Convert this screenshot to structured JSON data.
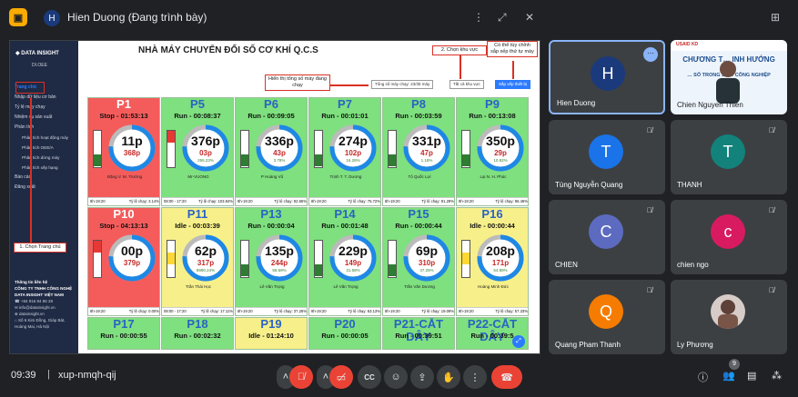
{
  "meeting": {
    "presenter_initial": "H",
    "presenter_title": "Hien Duong (Đang trình bày)",
    "time": "09:39",
    "separator": "|",
    "code": "xup-nmqh-qij",
    "participant_count": "9"
  },
  "dashboard": {
    "logo": "DATA INSIGHT",
    "logo_sub": "DI.OEE",
    "title": "NHÀ MÁY CHUYỂN ĐỔI SỐ CƠ KHÍ Q.C.S",
    "filter_count": "Tổng số máy chạy: 23/35 máy",
    "filter_area": "Tất cả khu vực",
    "sort_button": "Sắp xếp thiết bị",
    "menu": [
      {
        "label": "Trang chủ",
        "active": true,
        "sub": false
      },
      {
        "label": "Nhập dữ liệu cơ bản",
        "active": false,
        "sub": false
      },
      {
        "label": "Tỷ lệ máy chạy",
        "active": false,
        "sub": false
      },
      {
        "label": "Nhiệm vụ sản xuất",
        "active": false,
        "sub": false
      },
      {
        "label": "Phân tích",
        "active": false,
        "sub": false
      },
      {
        "label": "Phân tích hoạt động máy",
        "active": false,
        "sub": true
      },
      {
        "label": "Phân tích OEE/A",
        "active": false,
        "sub": true
      },
      {
        "label": "Phân tích dừng máy",
        "active": false,
        "sub": true
      },
      {
        "label": "Phân tích xếp hạng",
        "active": false,
        "sub": true
      },
      {
        "label": "Báo cáo",
        "active": false,
        "sub": false
      },
      {
        "label": "Đăng xuất",
        "active": false,
        "sub": false
      }
    ],
    "contact": {
      "heading": "Thông tin liên hệ",
      "company": "CÔNG TY TNHH CÔNG NGHỆ DATA INSIGHT VIỆT NAM",
      "phone": "+84 916 84 86 28",
      "email": "info@datainsight.vn",
      "web": "datainsight.vn",
      "address": "Số 6 Kim Đồng, Giáp Bát, Hoàng Mai, Hà Nội"
    },
    "annotations": {
      "home": "1. Chọn Trang chủ",
      "count": "Hiển thị tổng số máy đang chạy",
      "area": "2. Chọn khu vực",
      "sort": "Có thể tùy chỉnh sắp xếp thứ tự máy"
    },
    "machines": [
      {
        "name": "P1",
        "status": "Stop - 01:53:13",
        "color": "red",
        "main": "11p",
        "sub": "368p",
        "pct": "0.00%",
        "operator": "Đặng V. M. Trường",
        "shift": "8h-19:20",
        "rate": "Tỷ lệ chạy: 3.14%",
        "light": "green"
      },
      {
        "name": "P5",
        "status": "Run - 00:08:37",
        "color": "green",
        "main": "376p",
        "sub": "03p",
        "pct": "255.23%",
        "operator": "Mr-VUONG",
        "shift": "08:00 - 17:20",
        "rate": "Tỷ lệ chạy: 103.84%",
        "light": "red"
      },
      {
        "name": "P6",
        "status": "Run - 00:09:05",
        "color": "green",
        "main": "336p",
        "sub": "43p",
        "pct": "3.78%",
        "operator": "P Hoàng Vũ",
        "shift": "8h-19:20",
        "rate": "Tỷ lệ chạy: 92.65%",
        "light": "green"
      },
      {
        "name": "P7",
        "status": "Run - 00:01:01",
        "color": "green",
        "main": "274p",
        "sub": "102p",
        "pct": "16.28%",
        "operator": "Trịnh T. T. Dương",
        "shift": "8h-19:20",
        "rate": "Tỷ lệ chạy: 75.72%",
        "light": "green"
      },
      {
        "name": "P8",
        "status": "Run - 00:03:59",
        "color": "green",
        "main": "331p",
        "sub": "47p",
        "pct": "1.18%",
        "operator": "Tô Quốc Lợi",
        "shift": "8h-19:20",
        "rate": "Tỷ lệ chạy: 91.29%",
        "light": "green"
      },
      {
        "name": "P9",
        "status": "Run - 00:13:08",
        "color": "green",
        "main": "350p",
        "sub": "29p",
        "pct": "10.82%",
        "operator": "Lại N. H. Phúc",
        "shift": "8h-19:20",
        "rate": "Tỷ lệ chạy: 96.46%",
        "light": "green"
      },
      {
        "name": "P10",
        "status": "Stop - 04:13:13",
        "color": "red",
        "main": "00p",
        "sub": "379p",
        "pct": "0.00%",
        "operator": "",
        "shift": "8h-19:20",
        "rate": "Tỷ lệ chạy: 0.00%",
        "light": "red"
      },
      {
        "name": "P11",
        "status": "Idle - 00:03:39",
        "color": "yellow",
        "main": "62p",
        "sub": "317p",
        "pct": "8990.24%",
        "operator": "Trần Thái Học",
        "shift": "08:00 - 17:20",
        "rate": "Tỷ lệ chạy: 17.11%",
        "light": "yellow"
      },
      {
        "name": "P13",
        "status": "Run - 00:00:04",
        "color": "green",
        "main": "135p",
        "sub": "244p",
        "pct": "58.59%",
        "operator": "Lê Văn Trọng",
        "shift": "8h-19:20",
        "rate": "Tỷ lệ chạy: 37.25%",
        "light": "green"
      },
      {
        "name": "P14",
        "status": "Run - 00:01:48",
        "color": "green",
        "main": "229p",
        "sub": "149p",
        "pct": "31.58%",
        "operator": "Lê Văn Trọng",
        "shift": "8h-19:20",
        "rate": "Tỷ lệ chạy: 63.13%",
        "light": "green"
      },
      {
        "name": "P15",
        "status": "Run - 00:00:44",
        "color": "green",
        "main": "69p",
        "sub": "310p",
        "pct": "47.25%",
        "operator": "Trần Văn Dương",
        "shift": "8h-19:20",
        "rate": "Tỷ lệ chạy: 19.09%",
        "light": "green"
      },
      {
        "name": "P16",
        "status": "Idle - 00:00:44",
        "color": "yellow",
        "main": "208p",
        "sub": "171p",
        "pct": "54.89%",
        "operator": "Hoàng Minh Đức",
        "shift": "8h-19:20",
        "rate": "Tỷ lệ chạy: 57.33%",
        "light": "yellow"
      },
      {
        "name": "P17",
        "status": "Run - 00:00:55",
        "color": "green"
      },
      {
        "name": "P18",
        "status": "Run - 00:02:32",
        "color": "green"
      },
      {
        "name": "P19",
        "status": "Idle - 01:24:10",
        "color": "yellow"
      },
      {
        "name": "P20",
        "status": "Run - 00:00:05",
        "color": "green"
      },
      {
        "name": "P21-CẮT DÂY",
        "status": "Run - 00:39:51",
        "color": "green"
      },
      {
        "name": "P22-CẮT DÂY",
        "status": "Run - 00:39:5",
        "color": "green"
      }
    ]
  },
  "participants": [
    {
      "name": "Hien Duong",
      "initial": "H",
      "color": "#1a3a7c",
      "selected": true
    },
    {
      "name": "Chien Nguyen Thien",
      "slide": true
    },
    {
      "name": "Tùng Nguyễn Quang",
      "initial": "T",
      "color": "#1a73e8"
    },
    {
      "name": "THANH",
      "initial": "T",
      "color": "#12827b"
    },
    {
      "name": "CHIEN",
      "initial": "C",
      "color": "#5c6bc0"
    },
    {
      "name": "chien ngo",
      "initial": "c",
      "color": "#d81b60"
    },
    {
      "name": "Quang Pham Thanh",
      "initial": "Q",
      "color": "#f57c00"
    },
    {
      "name": "Ly Phương",
      "photo": true
    }
  ],
  "slide": {
    "logos": "USAID   KD",
    "line1": "CHƯƠNG T… INH HƯỚNG",
    "line2": "… SỐ TRONG SẢ… CÔNG NGHIỆP"
  },
  "controls": {
    "cc_label": "CC",
    "mic_icon": "mic-off-icon",
    "cam_icon": "camera-off-icon",
    "accent_red": "#ea4335"
  }
}
